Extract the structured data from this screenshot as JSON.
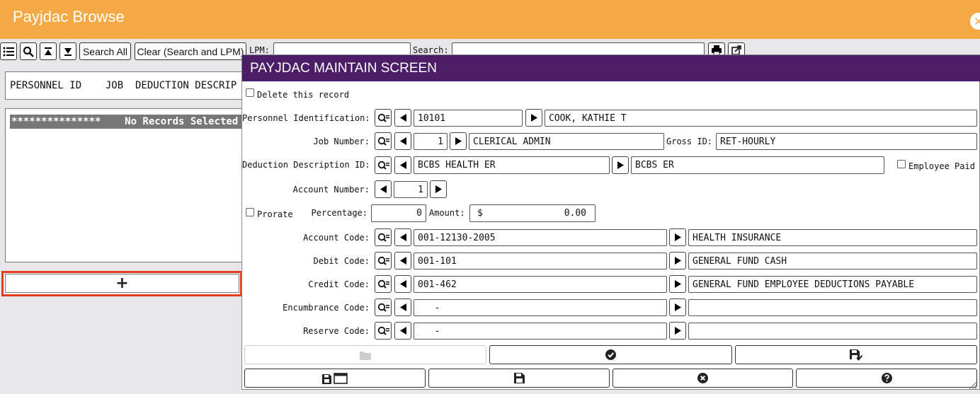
{
  "app": {
    "title": "Payjdac Browse"
  },
  "toolbar": {
    "search_all": "Search All",
    "clear": "Clear (Search and LPM)",
    "lpm_label": "LPM:",
    "lpm_value": "",
    "search_label": "Search:",
    "search_value": ""
  },
  "browse": {
    "header": "PERSONNEL ID    JOB  DEDUCTION DESCRIP",
    "row": "***************    No Records Selected",
    "add_symbol": "+"
  },
  "modal": {
    "title": "PAYJDAC MAINTAIN SCREEN",
    "delete_label": "Delete this record",
    "delete_checked": false,
    "fields": {
      "personnel": {
        "label": "Personnel Identification:",
        "value": "10101",
        "desc": "COOK, KATHIE T"
      },
      "job": {
        "label": "Job Number:",
        "value": "1",
        "desc": "CLERICAL ADMIN",
        "gross_label": "Gross ID:",
        "gross_value": "RET-HOURLY"
      },
      "deduction": {
        "label": "Deduction Description ID:",
        "value": "BCBS HEALTH ER",
        "desc": "BCBS ER",
        "employee_paid_label": "Employee Paid",
        "employee_paid_checked": false
      },
      "account_number": {
        "label": "Account Number:",
        "value": "1"
      },
      "prorate": {
        "label": "Prorate",
        "checked": false
      },
      "percentage": {
        "label": "Percentage:",
        "value": "0"
      },
      "amount": {
        "label": "Amount:",
        "currency": "$",
        "value": "0.00"
      },
      "account_code": {
        "label": "Account Code:",
        "value": "001-12130-2005",
        "desc": "HEALTH INSURANCE"
      },
      "debit_code": {
        "label": "Debit Code:",
        "value": "001-101",
        "desc": "GENERAL FUND CASH"
      },
      "credit_code": {
        "label": "Credit Code:",
        "value": "001-462",
        "desc": "GENERAL FUND EMPLOYEE DEDUCTIONS PAYABLE"
      },
      "encumbrance_code": {
        "label": "Encumbrance Code:",
        "value": "   -",
        "desc": ""
      },
      "reserve_code": {
        "label": "Reserve Code:",
        "value": "   -",
        "desc": ""
      }
    }
  },
  "icons": {
    "list": "list-icon",
    "search": "magnifier-icon",
    "top": "arrow-top-icon",
    "bottom": "arrow-bottom-icon",
    "print": "printer-icon",
    "export": "export-icon",
    "lookup": "lookup-icon",
    "folder": "folder-icon",
    "check": "check-circle-icon",
    "save_check": "save-check-icon",
    "save_window": "save-window-icon",
    "save": "save-icon",
    "cancel": "cancel-circle-icon",
    "help": "help-circle-icon"
  },
  "colors": {
    "titlebar": "#f5a945",
    "modal_header": "#4a1d66",
    "highlight": "#e53b1d"
  }
}
